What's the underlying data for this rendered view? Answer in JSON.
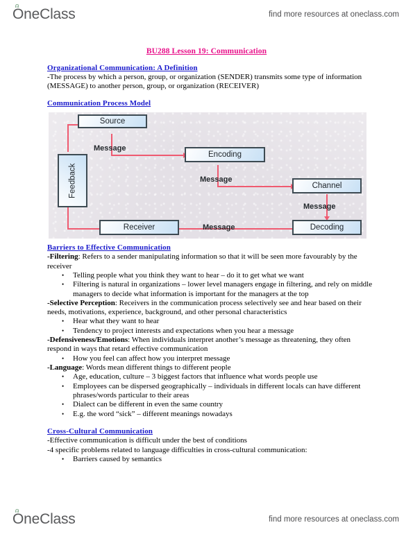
{
  "brand": {
    "logo_text_o": "O",
    "logo_text_rest": "neClass",
    "tagline": "find more resources at oneclass.com"
  },
  "document": {
    "title": "BU288 Lesson 19: Communication",
    "sections": {
      "definition": {
        "heading": "Organizational Communication: A Definition",
        "body": "-The process by which a person, group, or organization (SENDER) transmits some type of information (MESSAGE) to another person, group, or organization (RECEIVER)"
      },
      "process_model": {
        "heading": "Communication Process Model"
      },
      "barriers": {
        "heading": "Barriers to Effective Communication",
        "filtering_label": "-Filtering",
        "filtering_body": ": Refers to a sender manipulating information so that it will be seen more favourably by the receiver",
        "filtering_bullets": [
          "Telling people what you think they want to hear – do it to get what we want",
          "Filtering is natural in organizations – lower level managers engage in filtering, and rely on middle managers to decide what information is important for the managers at the top"
        ],
        "selective_label": "-Selective Perception",
        "selective_body": ": Receivers in the communication process selectively see and hear based on their needs, motivations, experience, background, and other personal characteristics",
        "selective_bullets": [
          "Hear what they want to hear",
          "Tendency to project interests and expectations when you hear a message"
        ],
        "defensiveness_label": "-Defensiveness/Emotions",
        "defensiveness_body": ": When individuals interpret another’s message as threatening, they often respond in ways that retard effective communication",
        "defensiveness_bullets": [
          "How you feel can affect how you interpret message"
        ],
        "language_label": "-Language",
        "language_body": ": Words mean different things to different people",
        "language_bullets": [
          "Age, education, culture – 3 biggest factors that influence what words people use",
          "Employees can be dispersed geographically – individuals in different locals can have different phrases/words particular to their areas",
          "Dialect can be different in even the same country",
          "E.g. the word “sick” – different meanings nowadays"
        ]
      },
      "cross_cultural": {
        "heading": "Cross-Cultural Communication",
        "line1": "-Effective communication is difficult under the best of conditions",
        "line2": "-4 specific problems related to language difficulties in cross-cultural communication:",
        "bullets": [
          "Barriers caused by semantics"
        ]
      }
    }
  },
  "diagram": {
    "nodes": {
      "source": "Source",
      "encoding": "Encoding",
      "channel": "Channel",
      "decoding": "Decoding",
      "receiver": "Receiver",
      "feedback": "Feedback"
    },
    "edge_labels": {
      "source_to_encoding": "Message",
      "encoding_to_channel": "Message",
      "channel_to_decoding": "Message",
      "decoding_to_receiver": "Message"
    },
    "colors": {
      "arrow": "#ef5a70",
      "node_border": "#3d4a52",
      "node_fill": "#c9e1f5",
      "canvas": "#e4e0e6"
    }
  },
  "theme": {
    "title_color": "#e8118a",
    "heading_color": "#1a1acc",
    "body_color": "#000000"
  }
}
